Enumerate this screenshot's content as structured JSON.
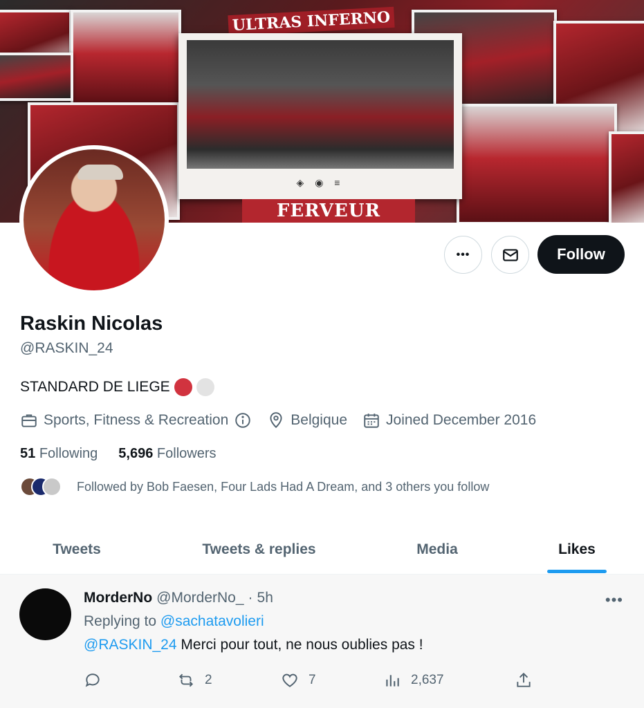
{
  "banner": {
    "strap_text": "FERVEUR FIDELITE",
    "top_strap_text": "ULTRAS INFERNO",
    "poster_logos": "◈ ◉ ≡"
  },
  "profile": {
    "name": "Raskin Nicolas",
    "handle": "@RASKIN_24",
    "bio": "STANDARD DE LIEGE",
    "bio_colors": [
      "#d1333f",
      "#e3e3e3"
    ],
    "category": "Sports, Fitness & Recreation",
    "location": "Belgique",
    "joined": "Joined December 2016",
    "following_count": "51",
    "following_label": "Following",
    "followers_count": "5,696",
    "followers_label": "Followers",
    "followed_by": "Followed by Bob Faesen, Four Lads Had A Dream, and 3 others you follow"
  },
  "actions": {
    "more_label": "•••",
    "follow_label": "Follow"
  },
  "tabs": [
    {
      "label": "Tweets"
    },
    {
      "label": "Tweets & replies"
    },
    {
      "label": "Media"
    },
    {
      "label": "Likes",
      "active": true
    }
  ],
  "tweet": {
    "display_name": "MorderNo",
    "handle": "@MorderNo_",
    "separator": "·",
    "time": "5h",
    "more": "•••",
    "replying_prefix": "Replying to",
    "replying_to": "@sachatavolieri",
    "mention": "@RASKIN_24",
    "text": "Merci pour tout, ne nous oublies pas !",
    "retweets": "2",
    "likes": "7",
    "views": "2,637"
  },
  "colors": {
    "accent": "#1d9bf0",
    "text": "#0f1419",
    "muted": "#536471"
  }
}
